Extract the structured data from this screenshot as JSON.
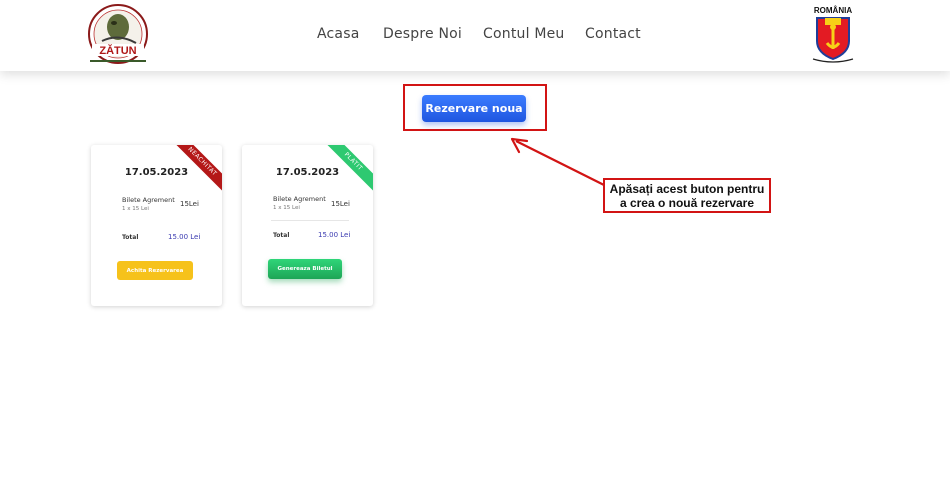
{
  "header": {
    "logo_left_text": "ZĂTUN",
    "nav": [
      "Acasa",
      "Despre Noi",
      "Contul Meu",
      "Contact"
    ],
    "logo_right_text": "ROMÂNIA"
  },
  "main": {
    "new_reservation_button": "Rezervare noua",
    "callout": "Apăsați acest buton pentru a crea o nouă rezervare"
  },
  "cards": [
    {
      "status": "NEACHITAT",
      "date": "17.05.2023",
      "item_name": "Bilete Agrement",
      "item_qty": "1 x 15 Lei",
      "item_price": "15Lei",
      "total_label": "Total",
      "total_value": "15.00 Lei",
      "action": "Achita Rezervarea"
    },
    {
      "status": "PLATIT",
      "date": "17.05.2023",
      "item_name": "Bilete Agrement",
      "item_qty": "1 x 15 Lei",
      "item_price": "15Lei",
      "total_label": "Total",
      "total_value": "15.00 Lei",
      "action": "Genereaza Biletul"
    }
  ],
  "colors": {
    "accent_blue": "#1f56e0",
    "highlight_red": "#d21414",
    "unpaid_red": "#b41818",
    "paid_green": "#2ec971",
    "pay_yellow": "#f6c21b"
  }
}
